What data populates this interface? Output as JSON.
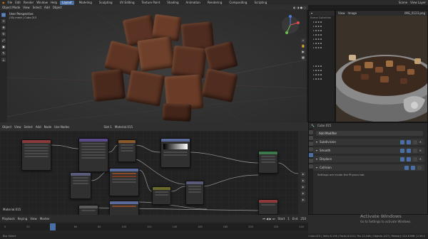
{
  "topbar": {
    "menu": [
      "File",
      "Edit",
      "Render",
      "Window",
      "Help"
    ],
    "tabs": [
      "Layout",
      "Modeling",
      "Sculpting",
      "UV Editing",
      "Texture Paint",
      "Shading",
      "Animation",
      "Rendering",
      "Compositing",
      "Scripting"
    ],
    "active_tab": "Layout",
    "scene": "Scene",
    "view_layer": "View Layer"
  },
  "viewport": {
    "mode": "Object Mode",
    "menu": [
      "View",
      "Select",
      "Add",
      "Object"
    ],
    "perspective": "User Perspective",
    "object_info": "(30) mesh | Cube.015"
  },
  "outliner": {
    "title": "Scene Collection"
  },
  "image_panel": {
    "header": "IMG_0123.png",
    "menu": [
      "View",
      "Image"
    ]
  },
  "node_editor": {
    "menu": [
      "Object",
      "View",
      "Select",
      "Add",
      "Node",
      "Use Nodes"
    ],
    "slot": "Slot 1",
    "material": "Material.015",
    "label": "Material.015"
  },
  "properties": {
    "object": "Cube.015",
    "add_modifier": "Add Modifier",
    "modifiers": [
      "Subdivision",
      "Smooth",
      "Displace",
      "Collision"
    ],
    "note": "Settings are inside the Physics tab"
  },
  "timeline": {
    "menu": [
      "Playback",
      "Keying",
      "View",
      "Marker"
    ],
    "frames": [
      "0",
      "20",
      "40",
      "60",
      "80",
      "100",
      "120",
      "140",
      "160",
      "180",
      "200",
      "220",
      "240"
    ],
    "start_label": "Start",
    "start": "1",
    "end_label": "End",
    "end": "250"
  },
  "status": {
    "left": "Box Select",
    "right": "Cube.015 | Verts 6,136 | Faces 6,024 | Tris 12,048 | Objects 1/27 | Memory 124.6 MiB | 2.90.1"
  },
  "watermark": {
    "title": "Activate Windows",
    "subtitle": "Go to Settings to activate Windows."
  }
}
